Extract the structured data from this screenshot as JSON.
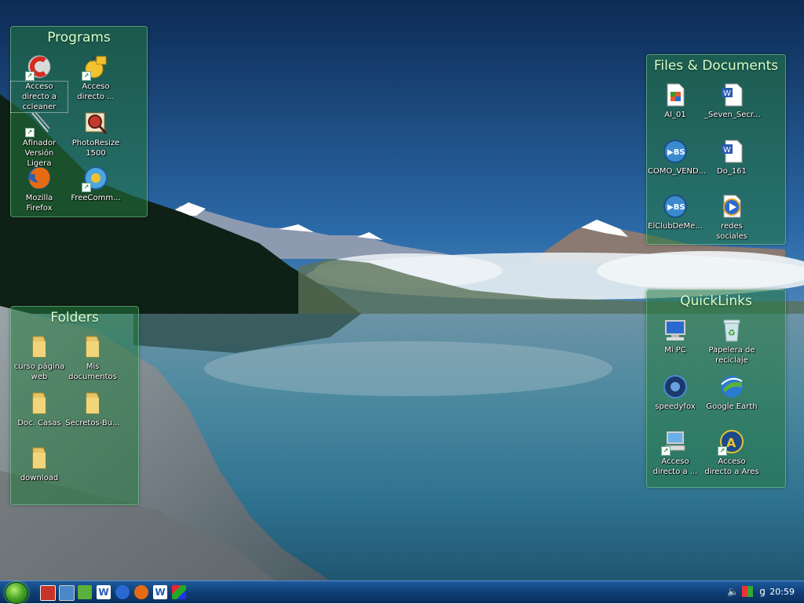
{
  "fences": {
    "programs": {
      "title": "Programs",
      "items": [
        {
          "label": "Acceso directo a ccleaner",
          "icon": "ccleaner-icon"
        },
        {
          "label": "Acceso directo ...",
          "icon": "game-shortcut-icon"
        },
        {
          "label": "Afinador Versión Ligera",
          "icon": "tuning-fork-icon"
        },
        {
          "label": "PhotoResize 1500",
          "icon": "photoresize-icon"
        },
        {
          "label": "Mozilla Firefox",
          "icon": "firefox-icon"
        },
        {
          "label": "FreeComm...",
          "icon": "freecommander-icon"
        }
      ]
    },
    "files": {
      "title": "Files & Documents",
      "items": [
        {
          "label": "AI_01",
          "icon": "image-file-icon"
        },
        {
          "label": "_Seven_Secr...",
          "icon": "word-document-icon"
        },
        {
          "label": "COMO_VEND...",
          "icon": "video-file-icon"
        },
        {
          "label": "Do_161",
          "icon": "word-document-icon"
        },
        {
          "label": "ElClubDeMe...",
          "icon": "video-file-icon"
        },
        {
          "label": "redes sociales",
          "icon": "media-file-icon"
        }
      ]
    },
    "folders": {
      "title": "Folders",
      "items": [
        {
          "label": "curso página web",
          "icon": "folder-icon"
        },
        {
          "label": "Mis documentos",
          "icon": "folder-icon"
        },
        {
          "label": "Doc. Casas",
          "icon": "folder-icon"
        },
        {
          "label": "Secretos-Bu...",
          "icon": "folder-icon"
        },
        {
          "label": "download",
          "icon": "folder-icon"
        }
      ]
    },
    "quicklinks": {
      "title": "QuickLinks",
      "items": [
        {
          "label": "Mi PC",
          "icon": "computer-icon"
        },
        {
          "label": "Papelera de reciclaje",
          "icon": "recycle-bin-icon"
        },
        {
          "label": "speedyfox",
          "icon": "speedyfox-icon"
        },
        {
          "label": "Google Earth",
          "icon": "google-earth-icon"
        },
        {
          "label": "Acceso directo a ...",
          "icon": "computer-shortcut-icon"
        },
        {
          "label": "Acceso directo a Ares",
          "icon": "ares-icon"
        }
      ]
    }
  },
  "taskbar": {
    "clock": "20:59",
    "quick_launch": [
      "media-icon",
      "show-desktop-icon",
      "tool-icon",
      "word-icon",
      "media-player-icon",
      "firefox-icon",
      "word-icon",
      "paint-icon"
    ],
    "tray": [
      "volume-icon",
      "windows-flag-icon",
      "power-icon"
    ]
  },
  "colors": {
    "fence_bg": "#24783e",
    "fence_title": "#d8ffc8",
    "taskbar": "#0f3f78",
    "sky_top": "#10305a",
    "water": "#3e7f95"
  }
}
